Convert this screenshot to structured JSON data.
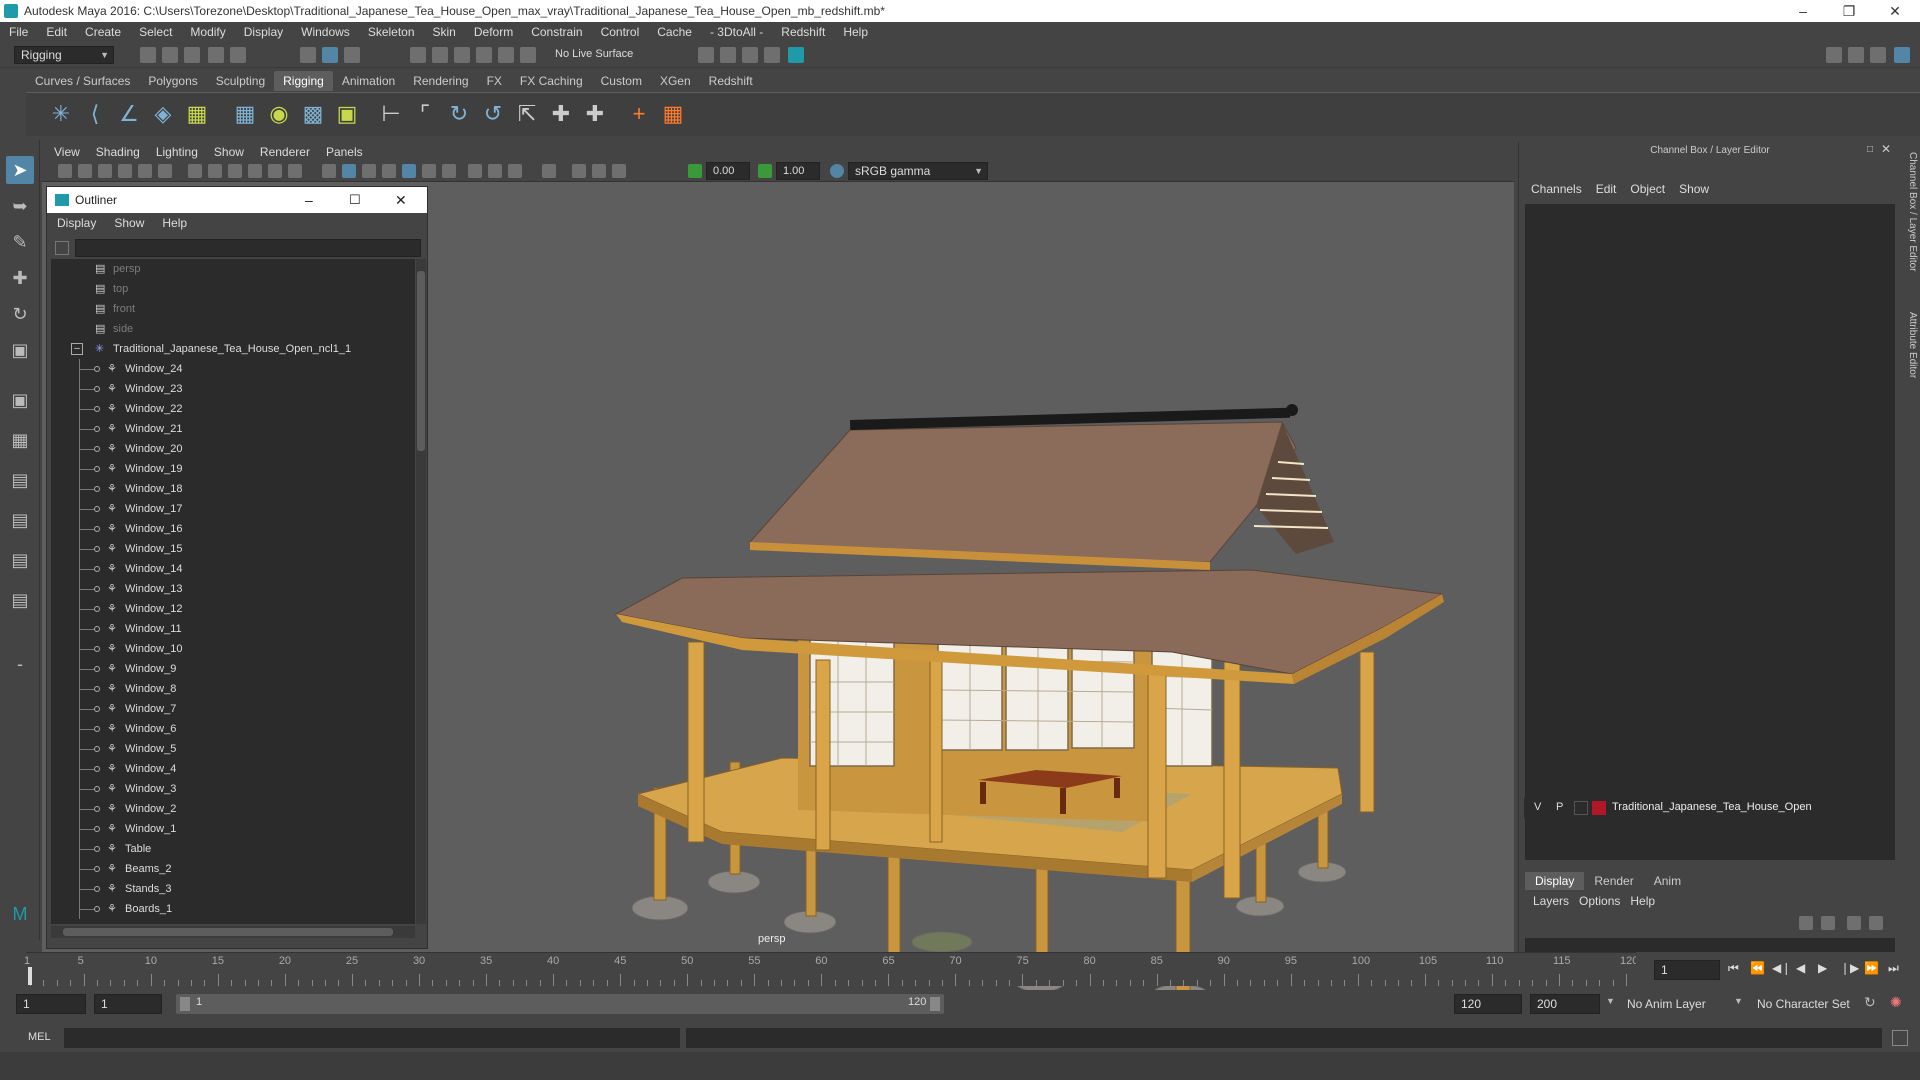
{
  "window": {
    "title": "Autodesk Maya 2016: C:\\Users\\Torezone\\Desktop\\Traditional_Japanese_Tea_House_Open_max_vray\\Traditional_Japanese_Tea_House_Open_mb_redshift.mb*"
  },
  "menubar": [
    "File",
    "Edit",
    "Create",
    "Select",
    "Modify",
    "Display",
    "Windows",
    "Skeleton",
    "Skin",
    "Deform",
    "Constrain",
    "Control",
    "Cache",
    "- 3DtoAll -",
    "Redshift",
    "Help"
  ],
  "statusline": {
    "mode": "Rigging",
    "live_surface": "No Live Surface"
  },
  "shelf_tabs": [
    "Curves / Surfaces",
    "Polygons",
    "Sculpting",
    "Rigging",
    "Animation",
    "Rendering",
    "FX",
    "FX Caching",
    "Custom",
    "XGen",
    "Redshift"
  ],
  "shelf_active": "Rigging",
  "viewport": {
    "menu": [
      "View",
      "Shading",
      "Lighting",
      "Show",
      "Renderer",
      "Panels"
    ],
    "exposure": "0.00",
    "gamma": "1.00",
    "color_space": "sRGB gamma",
    "camera_label": "persp"
  },
  "outliner": {
    "title": "Outliner",
    "menu": [
      "Display",
      "Show",
      "Help"
    ],
    "cameras": [
      "persp",
      "top",
      "front",
      "side"
    ],
    "root": "Traditional_Japanese_Tea_House_Open_ncl1_1",
    "children": [
      "Window_24",
      "Window_23",
      "Window_22",
      "Window_21",
      "Window_20",
      "Window_19",
      "Window_18",
      "Window_17",
      "Window_16",
      "Window_15",
      "Window_14",
      "Window_13",
      "Window_12",
      "Window_11",
      "Window_10",
      "Window_9",
      "Window_8",
      "Window_7",
      "Window_6",
      "Window_5",
      "Window_4",
      "Window_3",
      "Window_2",
      "Window_1",
      "Table",
      "Beams_2",
      "Stands_3",
      "Boards_1"
    ]
  },
  "channel_box": {
    "title": "Channel Box / Layer Editor",
    "menu": [
      "Channels",
      "Edit",
      "Object",
      "Show"
    ],
    "layer_tabs": [
      "Display",
      "Render",
      "Anim"
    ],
    "layer_tab_active": "Display",
    "layer_menu": [
      "Layers",
      "Options",
      "Help"
    ],
    "layer": {
      "v": "V",
      "p": "P",
      "name": "Traditional_Japanese_Tea_House_Open",
      "color": "#b0182a"
    },
    "side_tabs": [
      "Channel Box / Layer Editor",
      "Attribute Editor"
    ]
  },
  "timeline": {
    "ticks": [
      "1",
      "5",
      "10",
      "15",
      "20",
      "25",
      "30",
      "35",
      "40",
      "45",
      "50",
      "55",
      "60",
      "65",
      "70",
      "75",
      "80",
      "85",
      "90",
      "95",
      "100",
      "105",
      "110",
      "115",
      "120"
    ],
    "current_frame": "1"
  },
  "range": {
    "start": "1",
    "playback_start": "1",
    "slider_start": "1",
    "slider_end": "120",
    "playback_end": "120",
    "end": "200",
    "anim_layer": "No Anim Layer",
    "character_set": "No Character Set"
  },
  "command_line": {
    "language": "MEL"
  },
  "colors": {
    "accent": "#5285a6",
    "maya_teal": "#1e9aa8"
  }
}
